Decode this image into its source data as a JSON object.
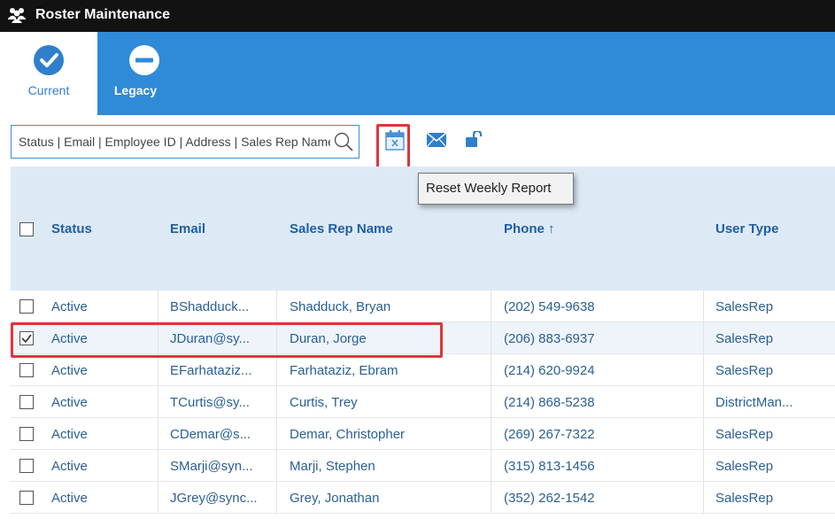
{
  "app": {
    "title": "Roster Maintenance",
    "icon": "users-icon"
  },
  "modes": {
    "current": {
      "label": "Current",
      "icon": "check-circle-icon"
    },
    "legacy": {
      "label": "Legacy",
      "icon": "minus-circle-icon"
    }
  },
  "search": {
    "placeholder": "Status | Email | Employee ID | Address | Sales Rep Name",
    "value": ""
  },
  "toolbar": {
    "reset_icon": "calendar-reset-icon",
    "mail_icon": "mail-icon",
    "unlock_icon": "unlock-icon"
  },
  "tooltip": {
    "text": "Reset Weekly Report"
  },
  "table": {
    "columns": {
      "status": "Status",
      "email": "Email",
      "name": "Sales Rep Name",
      "phone": "Phone ↑",
      "type": "User Type"
    },
    "rows": [
      {
        "checked": false,
        "status": "Active",
        "email": "BShadduck...",
        "name": "Shadduck, Bryan",
        "phone": "(202) 549-9638",
        "type": "SalesRep"
      },
      {
        "checked": true,
        "status": "Active",
        "email": "JDuran@sy...",
        "name": "Duran, Jorge",
        "phone": "(206) 883-6937",
        "type": "SalesRep"
      },
      {
        "checked": false,
        "status": "Active",
        "email": "EFarhataziz...",
        "name": "Farhataziz, Ebram",
        "phone": "(214) 620-9924",
        "type": "SalesRep"
      },
      {
        "checked": false,
        "status": "Active",
        "email": "TCurtis@sy...",
        "name": "Curtis, Trey",
        "phone": "(214) 868-5238",
        "type": "DistrictMan..."
      },
      {
        "checked": false,
        "status": "Active",
        "email": "CDemar@s...",
        "name": "Demar, Christopher",
        "phone": "(269) 267-7322",
        "type": "SalesRep"
      },
      {
        "checked": false,
        "status": "Active",
        "email": "SMarji@syn...",
        "name": "Marji, Stephen",
        "phone": "(315) 813-1456",
        "type": "SalesRep"
      },
      {
        "checked": false,
        "status": "Active",
        "email": "JGrey@sync...",
        "name": "Grey, Jonathan",
        "phone": "(352) 262-1542",
        "type": "SalesRep"
      }
    ]
  },
  "colors": {
    "accent": "#2f8ad8",
    "header_bg": "#dde9f5",
    "highlight": "#e0353b"
  }
}
